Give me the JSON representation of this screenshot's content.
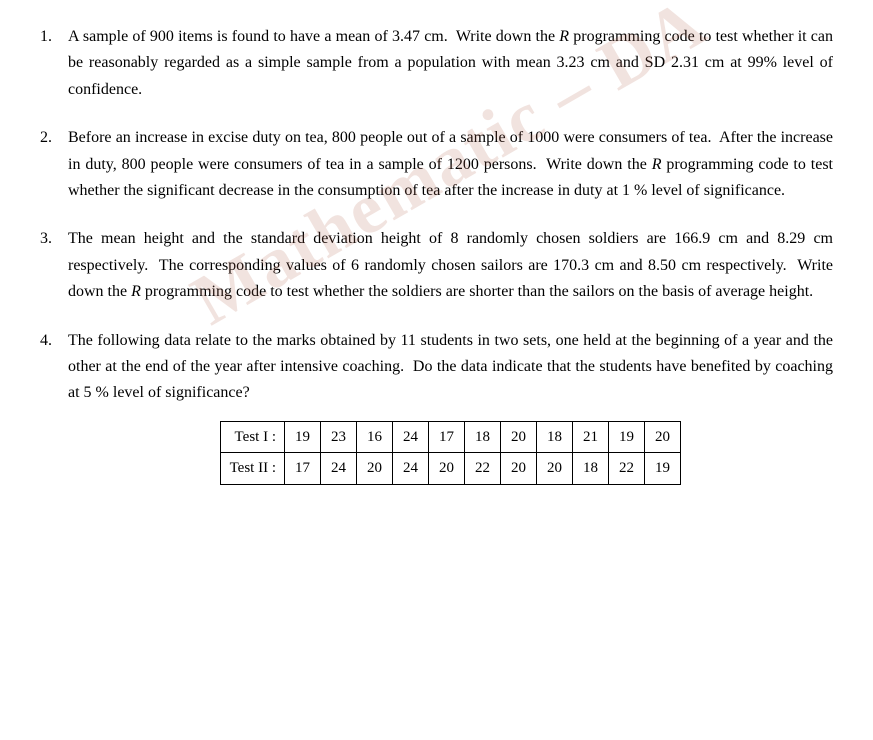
{
  "watermark": {
    "text": "Mathematic – DA"
  },
  "questions": [
    {
      "number": "1.",
      "text": "A sample of 900 items is found to have a mean of 3.47 cm.  Write down the R programming code to test whether it can be reasonably regarded as a simple sample from a population with mean 3.23 cm and SD 2.31 cm at 99% level of confidence."
    },
    {
      "number": "2.",
      "text": "Before an increase in excise duty on tea, 800 people out of a sample of 1000 were consumers of tea.  After the increase in duty, 800 people were consumers of tea in a sample of 1200 persons.  Write down the R programming code to test whether the significant decrease in the consumption of tea after the increase in duty at 1 % level of significance."
    },
    {
      "number": "3.",
      "text": "The mean height and the standard deviation height of 8 randomly chosen soldiers are 166.9 cm and 8.29 cm respectively.  The corresponding values of 6 randomly chosen sailors are 170.3 cm and 8.50 cm respectively.  Write down the R programming code to test whether the soldiers are shorter than the sailors on the basis of average height."
    },
    {
      "number": "4.",
      "text": "The following data relate to the marks obtained by 11 students in two sets, one held at the beginning of a year and the other at the end of the year after intensive coaching.  Do the data indicate that the students have benefited by coaching at 5 % level of significance?"
    }
  ],
  "table": {
    "rows": [
      {
        "label": "Test I :",
        "values": [
          "19",
          "23",
          "16",
          "24",
          "17",
          "18",
          "20",
          "18",
          "21",
          "19",
          "20"
        ]
      },
      {
        "label": "Test II :",
        "values": [
          "17",
          "24",
          "20",
          "24",
          "20",
          "22",
          "20",
          "20",
          "18",
          "22",
          "19"
        ]
      }
    ]
  }
}
